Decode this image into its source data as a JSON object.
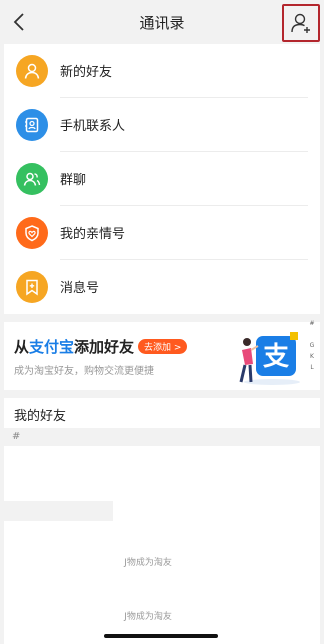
{
  "header": {
    "back_label": "<",
    "title": "通讯录"
  },
  "menu": {
    "items": [
      {
        "label": "新的好友",
        "icon": "person-icon",
        "color": "#F6A623"
      },
      {
        "label": "手机联系人",
        "icon": "contact-book-icon",
        "color": "#2D8FE7"
      },
      {
        "label": "群聊",
        "icon": "group-icon",
        "color": "#35C060"
      },
      {
        "label": "我的亲情号",
        "icon": "family-shield-icon",
        "color": "#FF6A1A"
      },
      {
        "label": "消息号",
        "icon": "bookmark-plus-icon",
        "color": "#F6A623"
      }
    ]
  },
  "banner": {
    "prefix": "从",
    "alipay": "支付宝",
    "suffix": "添加好友",
    "button": "去添加 >",
    "subtitle": "成为淘宝好友，购物交流更便捷"
  },
  "alphabet_index": [
    "#",
    "G",
    "K",
    "L"
  ],
  "friends": {
    "heading": "我的好友",
    "index_label": "#",
    "ghost_text_1": "J物成为淘友",
    "ghost_text_2": "J物成为淘友"
  },
  "colors": {
    "accent_orange": "#FF5A1F",
    "alipay_blue": "#1A7EE6",
    "highlight_red": "#B3262D"
  }
}
